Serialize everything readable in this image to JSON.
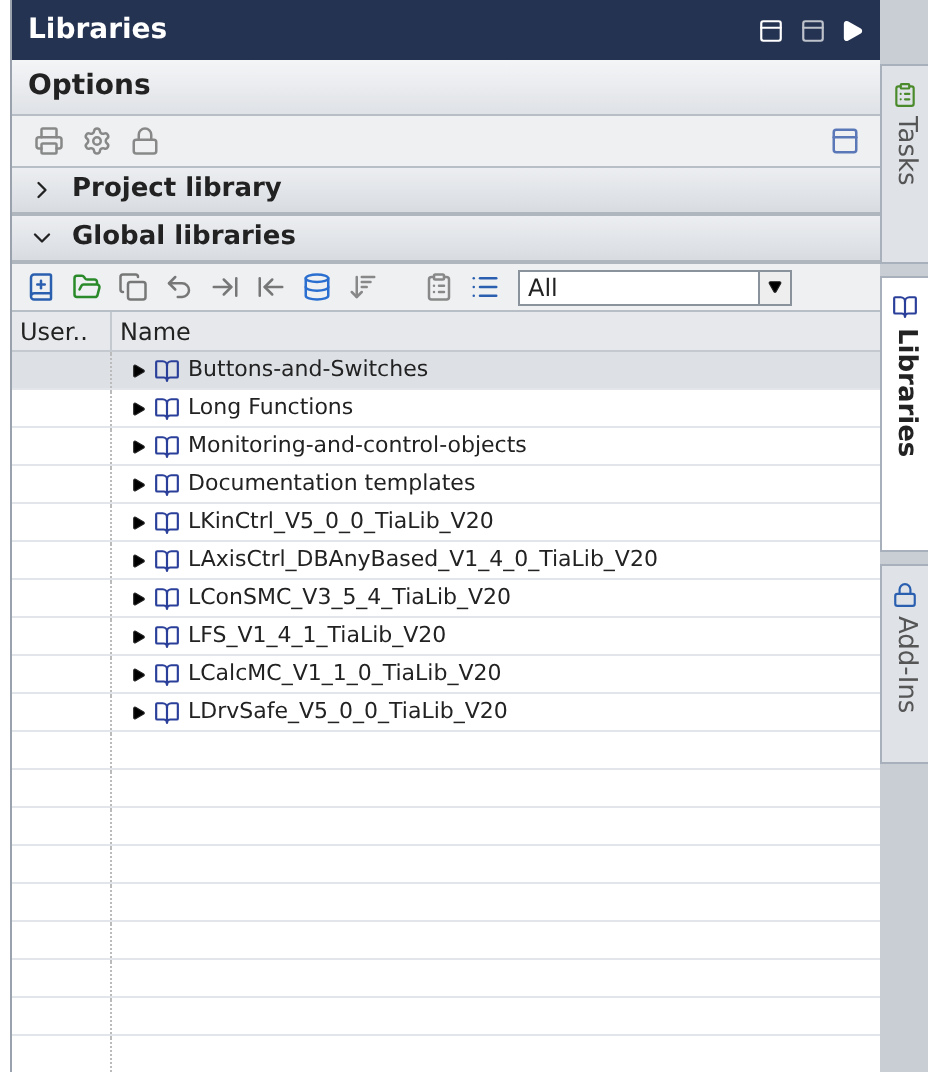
{
  "panel": {
    "title": "Libraries"
  },
  "options": {
    "title": "Options"
  },
  "sections": [
    {
      "title": "Project library",
      "expanded": false
    },
    {
      "title": "Global libraries",
      "expanded": true
    }
  ],
  "filter": {
    "value": "All"
  },
  "table": {
    "columns": [
      "User..",
      "Name"
    ],
    "rows": [
      {
        "name": "Buttons-and-Switches",
        "selected": true
      },
      {
        "name": "Long Functions",
        "selected": false
      },
      {
        "name": "Monitoring-and-control-objects",
        "selected": false
      },
      {
        "name": "Documentation templates",
        "selected": false
      },
      {
        "name": "LKinCtrl_V5_0_0_TiaLib_V20",
        "selected": false
      },
      {
        "name": "LAxisCtrl_DBAnyBased_V1_4_0_TiaLib_V20",
        "selected": false
      },
      {
        "name": "LConSMC_V3_5_4_TiaLib_V20",
        "selected": false
      },
      {
        "name": "LFS_V1_4_1_TiaLib_V20",
        "selected": false
      },
      {
        "name": "LCalcMC_V1_1_0_TiaLib_V20",
        "selected": false
      },
      {
        "name": "LDrvSafe_V5_0_0_TiaLib_V20",
        "selected": false
      }
    ]
  },
  "side_tabs": [
    {
      "label": "Tasks",
      "selected": false
    },
    {
      "label": "Libraries",
      "selected": true
    },
    {
      "label": "Add-Ins",
      "selected": false
    }
  ]
}
